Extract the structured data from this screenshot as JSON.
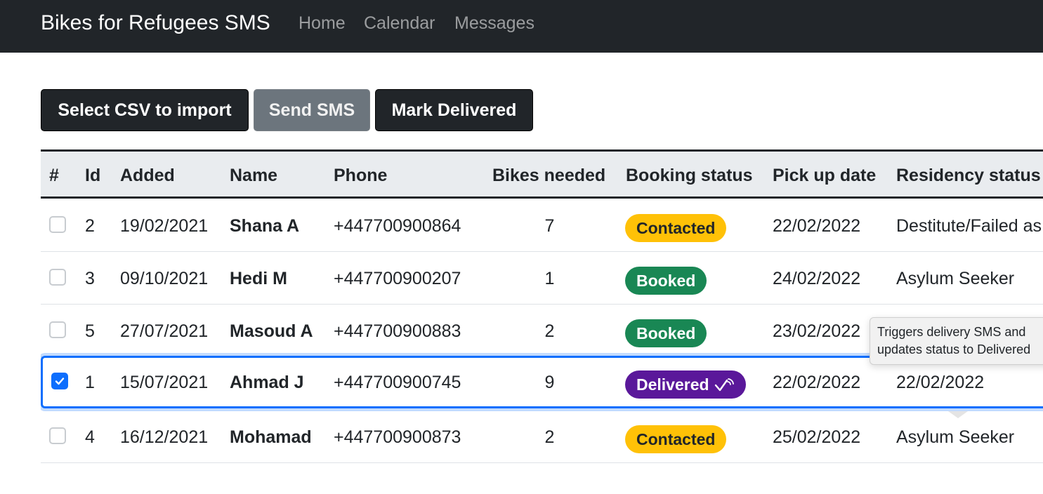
{
  "navbar": {
    "brand": "Bikes for Refugees SMS",
    "links": [
      "Home",
      "Calendar",
      "Messages"
    ]
  },
  "toolbar": {
    "import_label": "Select CSV to import",
    "send_label": "Send SMS",
    "deliver_label": "Mark Delivered"
  },
  "table": {
    "headers": [
      "#",
      "Id",
      "Added",
      "Name",
      "Phone",
      "Bikes needed",
      "Booking status",
      "Pick up date",
      "Residency status"
    ],
    "rows": [
      {
        "checked": false,
        "id": "2",
        "added": "19/02/2021",
        "name": "Shana A",
        "phone": "+447700900864",
        "bikes": "7",
        "booking": "Contacted",
        "pickup": "22/02/2022",
        "residency": "Destitute/Failed as"
      },
      {
        "checked": false,
        "id": "3",
        "added": "09/10/2021",
        "name": "Hedi M",
        "phone": "+447700900207",
        "bikes": "1",
        "booking": "Booked",
        "pickup": "24/02/2022",
        "residency": "Asylum Seeker"
      },
      {
        "checked": false,
        "id": "5",
        "added": "27/07/2021",
        "name": "Masoud A",
        "phone": "+447700900883",
        "bikes": "2",
        "booking": "Booked",
        "pickup": "23/02/2022",
        "residency": ""
      },
      {
        "checked": true,
        "id": "1",
        "added": "15/07/2021",
        "name": "Ahmad J",
        "phone": "+447700900745",
        "bikes": "9",
        "booking": "Delivered",
        "pickup": "22/02/2022",
        "residency": "22/02/2022"
      },
      {
        "checked": false,
        "id": "4",
        "added": "16/12/2021",
        "name": "Mohamad",
        "phone": "+447700900873",
        "bikes": "2",
        "booking": "Contacted",
        "pickup": "25/02/2022",
        "residency": "Asylum Seeker"
      }
    ]
  },
  "tooltip": {
    "line1": "Triggers delivery SMS and",
    "line2": "updates status to Delivered"
  },
  "colors": {
    "navbar_bg": "#212529",
    "contacted": "#ffc107",
    "booked": "#198754",
    "delivered": "#5a189a",
    "selection": "#0d6efd"
  },
  "icons": {
    "delivered_badge": "check-signal-icon",
    "checkbox_checked": "check-icon"
  }
}
